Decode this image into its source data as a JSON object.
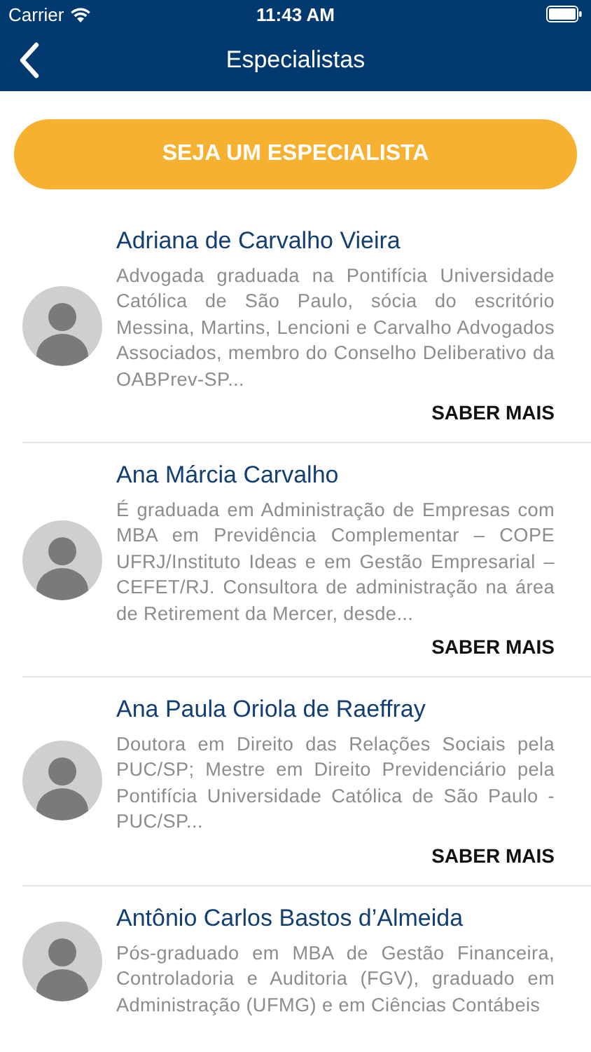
{
  "status_bar": {
    "carrier": "Carrier",
    "time": "11:43 AM"
  },
  "nav_bar": {
    "title": "Especialistas"
  },
  "cta_button": "SEJA UM ESPECIALISTA",
  "experts": [
    {
      "name": "Adriana de Carvalho Vieira",
      "bio": "Advogada graduada na Pontifícia Universidade Católica de São Paulo, sócia do escritório Messina, Martins, Lencioni e Carvalho Advogados Associados, membro do Conselho Deliberativo da OABPrev-SP...",
      "link": "SABER MAIS"
    },
    {
      "name": "Ana Márcia Carvalho",
      "bio": "É graduada em Administração de Empresas com MBA em Previdência Complementar – COPE UFRJ/Instituto Ideas e em Gestão Empresarial – CEFET/RJ. Consultora de administração na área de Retirement da Mercer, desde...",
      "link": "SABER MAIS"
    },
    {
      "name": "Ana Paula Oriola de Raeffray",
      "bio": "Doutora em Direito das Relações Sociais pela PUC/SP; Mestre em Direito Previdenciário pela Pontifícia Universidade Católica de São Paulo - PUC/SP...",
      "link": "SABER MAIS"
    },
    {
      "name": "Antônio Carlos Bastos d’Almeida",
      "bio": "Pós-graduado em MBA de Gestão Financeira, Controladoria e Auditoria (FGV), graduado em Administração (UFMG) e em Ciências Contábeis"
    }
  ]
}
